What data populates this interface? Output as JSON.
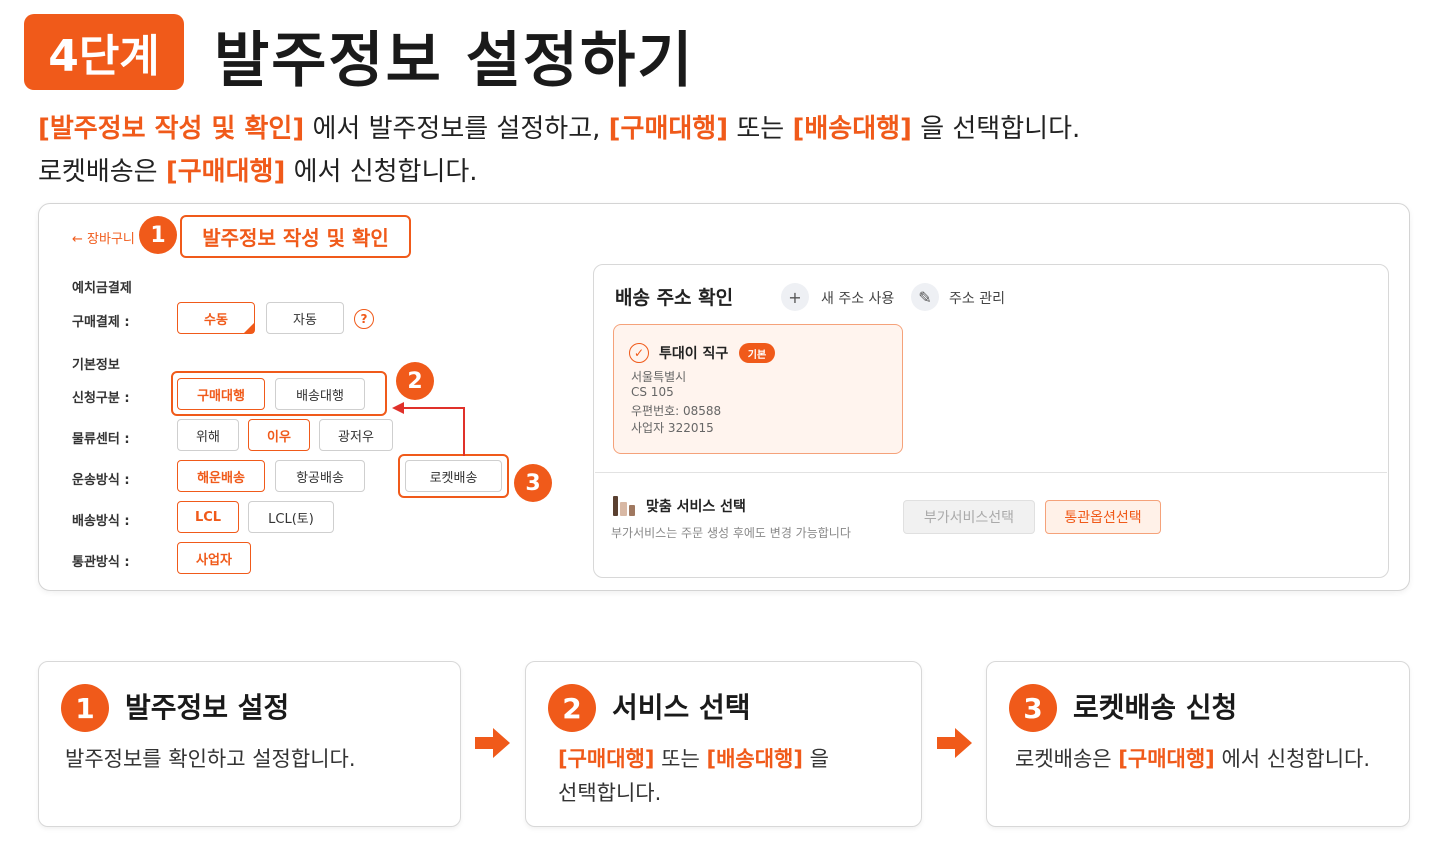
{
  "header": {
    "step_badge": "4단계",
    "title": "발주정보 설정하기"
  },
  "intro": {
    "line1": {
      "hl1": "[발주정보 작성 및 확인]",
      "t1": " 에서 발주정보를 설정하고, ",
      "hl2": "[구매대행]",
      "t2": " 또는 ",
      "hl3": "[배송대행]",
      "t3": " 을 선택합니다."
    },
    "line2": {
      "t1": "로켓배송은 ",
      "hl1": "[구매대행]",
      "t2": " 에서 신청합니다."
    }
  },
  "mockup": {
    "back_link": "← 장바구니",
    "tab_title": "발주정보 작성 및 확인",
    "callouts": [
      "1",
      "2",
      "3"
    ],
    "deposit_section": "예치금결제",
    "payment_label": "구매결제 :",
    "payment_options": [
      "수동",
      "자동"
    ],
    "help_mark": "?",
    "basic_section": "기본정보",
    "apply_label": "신청구분 :",
    "apply_options": [
      "구매대행",
      "배송대행"
    ],
    "center_label": "물류센터 :",
    "center_options": [
      "위해",
      "이우",
      "광저우"
    ],
    "transport_label": "운송방식 :",
    "transport_options": [
      "해운배송",
      "항공배송"
    ],
    "rocket_option": "로켓배송",
    "delivery_label": "배송방식 :",
    "delivery_options": [
      "LCL",
      "LCL(토)"
    ],
    "customs_label": "통관방식 :",
    "customs_options": [
      "사업자"
    ],
    "address": {
      "title": "배송 주소 확인",
      "new_address": "새 주소 사용",
      "manage": "주소 관리",
      "plus_icon": "+",
      "pencil_icon": "✎",
      "check_icon": "✓",
      "card_name": "투대이 직구",
      "card_badge": "기본",
      "card_lines": [
        "서울특별시",
        "CS 105",
        "우편번호: 08588",
        "사업자 322015"
      ]
    },
    "service": {
      "title": "맞춤 서비스 선택",
      "desc": "부가서비스는 주문 생성 후에도 변경 가능합니다",
      "btn_addon": "부가서비스선택",
      "btn_customs": "통관옵션선택"
    }
  },
  "steps": [
    {
      "num": "1",
      "title": "발주정보 설정",
      "desc": "발주정보를 확인하고 설정합니다."
    },
    {
      "num": "2",
      "title": "서비스 선택",
      "hl1": "[구매대행]",
      "t1": " 또는 ",
      "hl2": "[배송대행]",
      "t2": " 을",
      "t3": "선택합니다."
    },
    {
      "num": "3",
      "title": "로켓배송 신청",
      "t1": "로켓배송은 ",
      "hl1": "[구매대행]",
      "t2": " 에서 신청합니다."
    }
  ],
  "colors": {
    "accent": "#f05a1a",
    "accent_light": "#fff4ee"
  }
}
